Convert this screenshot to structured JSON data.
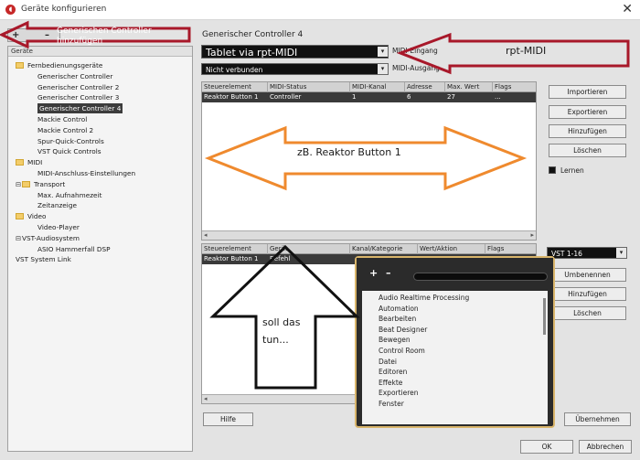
{
  "window": {
    "title": "Geräte konfigurieren",
    "close_glyph": "✕"
  },
  "left": {
    "toolbar": {
      "add": "+",
      "remove": "–"
    },
    "header": "Geräte",
    "tree": [
      {
        "label": "Fernbedienungsgeräte",
        "indent": 0,
        "folder": true,
        "exp": ""
      },
      {
        "label": "Generischer Controller",
        "indent": 1,
        "folder": false,
        "exp": ""
      },
      {
        "label": "Generischer Controller 2",
        "indent": 1,
        "folder": false,
        "exp": ""
      },
      {
        "label": "Generischer Controller 3",
        "indent": 1,
        "folder": false,
        "exp": ""
      },
      {
        "label": "Generischer Controller 4",
        "indent": 1,
        "folder": false,
        "exp": "",
        "selected": true
      },
      {
        "label": "Mackie Control",
        "indent": 1,
        "folder": false,
        "exp": ""
      },
      {
        "label": "Mackie Control 2",
        "indent": 1,
        "folder": false,
        "exp": ""
      },
      {
        "label": "Spur-Quick-Controls",
        "indent": 1,
        "folder": false,
        "exp": ""
      },
      {
        "label": "VST Quick Controls",
        "indent": 1,
        "folder": false,
        "exp": ""
      },
      {
        "label": "MIDI",
        "indent": 0,
        "folder": true,
        "exp": ""
      },
      {
        "label": "MIDI-Anschluss-Einstellungen",
        "indent": 1,
        "folder": false,
        "exp": ""
      },
      {
        "label": "Transport",
        "indent": 0,
        "folder": true,
        "exp": "⊟"
      },
      {
        "label": "Max. Aufnahmezeit",
        "indent": 1,
        "folder": false,
        "exp": ""
      },
      {
        "label": "Zeitanzeige",
        "indent": 1,
        "folder": false,
        "exp": ""
      },
      {
        "label": "Video",
        "indent": 0,
        "folder": true,
        "exp": ""
      },
      {
        "label": "Video-Player",
        "indent": 1,
        "folder": false,
        "exp": ""
      },
      {
        "label": "VST-Audiosystem",
        "indent": 0,
        "folder": false,
        "exp": "⊟"
      },
      {
        "label": "ASIO Hammerfall DSP",
        "indent": 1,
        "folder": false,
        "exp": ""
      },
      {
        "label": "VST System Link",
        "indent": 0,
        "folder": false,
        "exp": ""
      }
    ]
  },
  "main": {
    "title": "Generischer Controller 4",
    "midi_in": {
      "value": "Tablet via rpt-MIDI",
      "label": "MIDI-Eingang"
    },
    "midi_out": {
      "value": "Nicht verbunden",
      "label": "MIDI-Ausgang"
    },
    "table1": {
      "headers": [
        "Steuerelement",
        "MIDI-Status",
        "MIDI-Kanal",
        "Adresse",
        "Max. Wert",
        "Flags"
      ],
      "rows": [
        [
          "Reaktor Button 1",
          "Controller",
          "1",
          "6",
          "27",
          "..."
        ]
      ]
    },
    "table2": {
      "headers": [
        "Steuerelement",
        "Gerät",
        "Kanal/Kategorie",
        "Wert/Aktion",
        "Flags"
      ],
      "rows": [
        [
          "Reaktor Button 1",
          "Befehl"
        ]
      ]
    },
    "buttons_top": [
      "Importieren",
      "Exportieren",
      "Hinzufügen",
      "Löschen"
    ],
    "learn_label": "Lernen",
    "bank": "VST 1-16",
    "buttons_bottom": [
      "Umbenennen",
      "Hinzufügen",
      "Löschen"
    ],
    "help": "Hilfe",
    "apply": "Übernehmen",
    "ok": "OK",
    "cancel": "Abbrechen"
  },
  "popup": {
    "plus": "+",
    "minus": "–",
    "items": [
      "Audio Realtime Processing",
      "Automation",
      "Bearbeiten",
      "Beat Designer",
      "Bewegen",
      "Control Room",
      "Datei",
      "Editoren",
      "Effekte",
      "Exportieren",
      "Fenster"
    ]
  },
  "annotations": {
    "add_controller": "Generischen Controller hinzufügen",
    "rpt_midi": "rpt-MIDI",
    "reaktor": "zB. Reaktor Button 1",
    "soll": "soll das tun..."
  },
  "colors": {
    "arrow_red": "#a8182a",
    "arrow_orange": "#ef8a2e",
    "popup_border": "#d9b56b"
  }
}
